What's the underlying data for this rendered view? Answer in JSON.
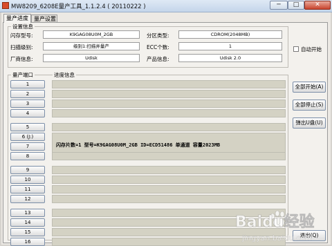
{
  "window": {
    "title": "MW8209_6208E量产工具_1.1.2.4 ( 20110222 )",
    "minimize": "─",
    "maximize": "□",
    "close": "✕"
  },
  "tabs": [
    {
      "label": "量产进度"
    },
    {
      "label": "量产设置"
    }
  ],
  "settings": {
    "group_title": "设置信息",
    "flash_model_label": "闪存型号:",
    "flash_model_value": "K9GAG08U0M_2GB",
    "scan_level_label": "扫描级别:",
    "scan_level_value": "级别1:扫描并量产",
    "vendor_label": "厂商信息:",
    "vendor_value": "Udisk",
    "partition_label": "分区类型:",
    "partition_value": "CDROM(2048MB)",
    "ecc_label": "ECC个数:",
    "ecc_value": "1",
    "product_label": "产品信息:",
    "product_value": "Udisk 2.0",
    "auto_start_label": "自动开始"
  },
  "ports": {
    "group_title": "量产端口",
    "progress_title": "进度信息",
    "items": [
      "1",
      "2",
      "3",
      "4",
      "5",
      "6 (J:)",
      "7",
      "8",
      "9",
      "10",
      "11",
      "12",
      "13",
      "14",
      "15",
      "16"
    ],
    "active_info": "闪存片数=1  型号=K9GAG08U0M_2GB  ID=ECD51486  单通道  容量2023MB"
  },
  "actions": {
    "start_all": "全部开始(A)",
    "stop_all": "全部停止(S)",
    "eject": "弹出U盘(U)",
    "exit": "退出(Q)"
  },
  "watermark": {
    "brand": "Baidu经验",
    "url": "jingyan.baidu.com"
  }
}
